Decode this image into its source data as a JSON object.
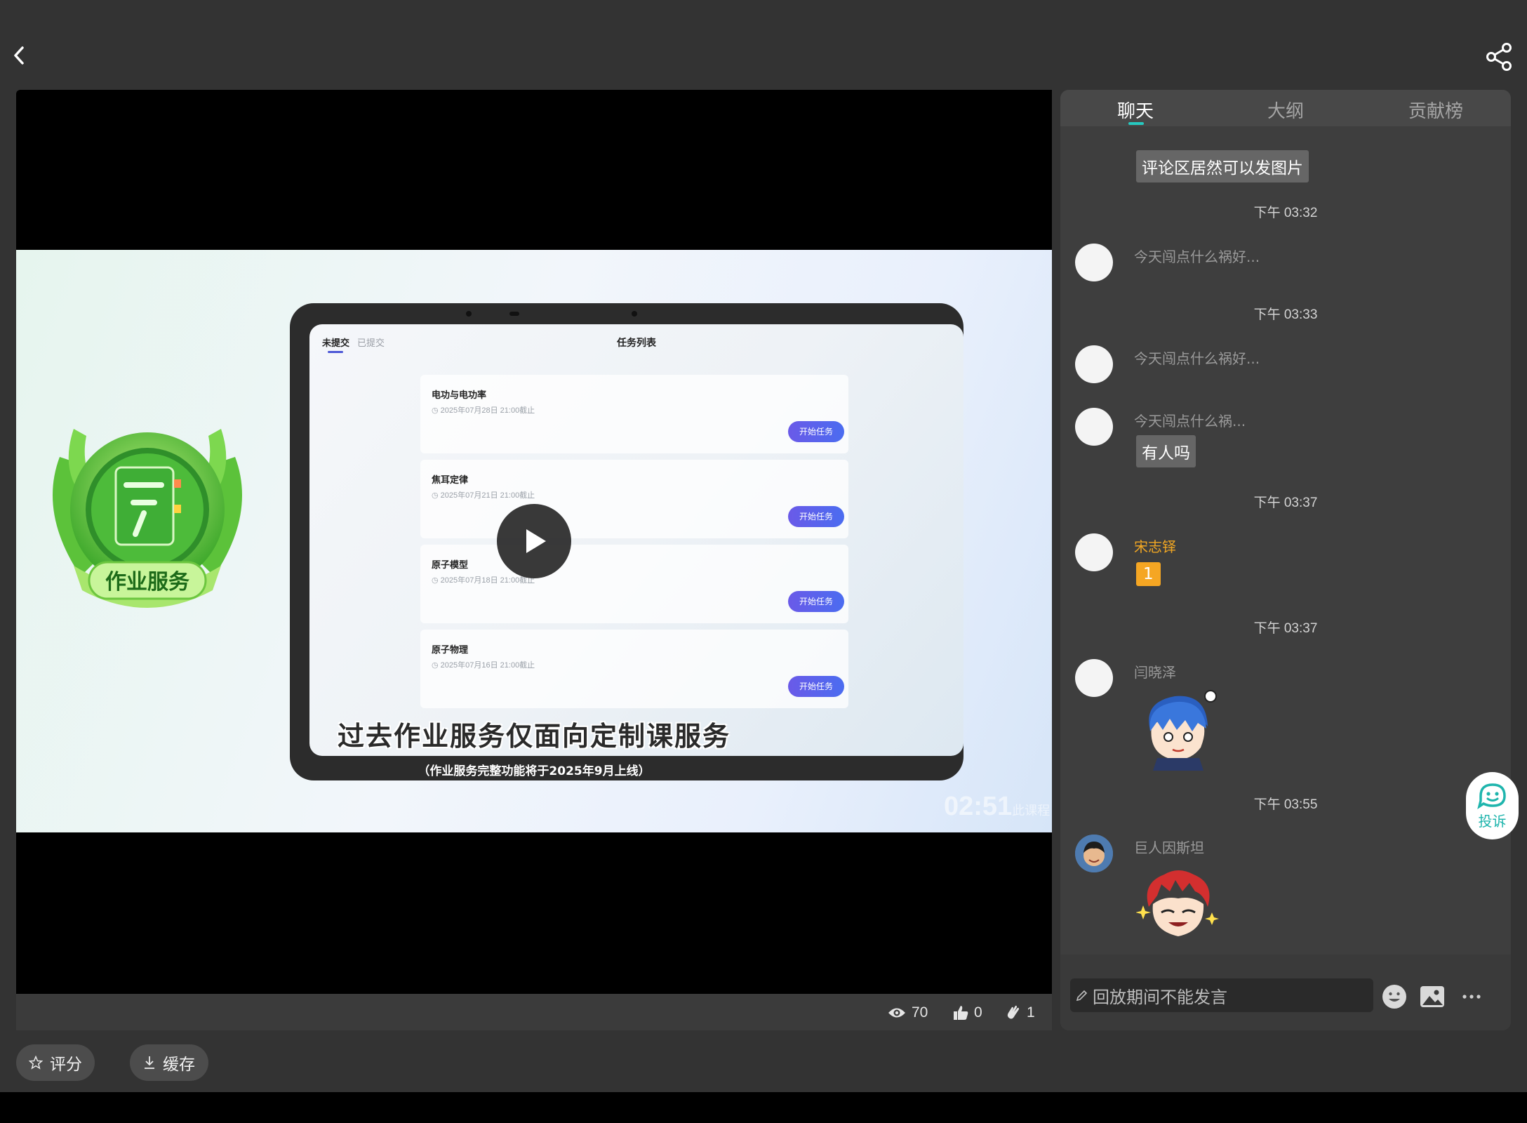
{
  "toolbar": {
    "back_icon": "chevron-left-icon",
    "share_icon": "share-icon"
  },
  "video": {
    "tablet_tabs": {
      "active": "未提交",
      "inactive": "已提交"
    },
    "tablet_title": "任务列表",
    "badge_text": "作业服务",
    "tasks": [
      {
        "title": "电功与电功率",
        "deadline": "2025年07月28日 21:00截止",
        "button": "开始任务"
      },
      {
        "title": "焦耳定律",
        "deadline": "2025年07月21日 21:00截止",
        "button": "开始任务"
      },
      {
        "title": "原子模型",
        "deadline": "2025年07月18日 21:00截止",
        "button": "开始任务"
      },
      {
        "title": "原子物理",
        "deadline": "2025年07月16日 21:00截止",
        "button": "开始任务"
      }
    ],
    "subtitle": "过去作业服务仅面向定制课服务",
    "subnote": "（作业服务完整功能将于2025年9月上线）",
    "timestamp_main": "02:51",
    "timestamp_suffix": "此课程",
    "stats": {
      "views": "70",
      "likes": "0",
      "claps": "1"
    }
  },
  "actions": {
    "rate_label": "评分",
    "cache_label": "缓存"
  },
  "chat": {
    "tabs": [
      "聊天",
      "大纲",
      "贡献榜"
    ],
    "active_tab": 0,
    "accent_color": "#26c9c0",
    "top_bubble": "评论区居然可以发图片",
    "items": [
      {
        "time": "下午 03:32"
      },
      {
        "name": "今天闯点什么祸好..."
      },
      {
        "time": "下午 03:33"
      },
      {
        "name": "今天闯点什么祸好..."
      },
      {
        "name": "今天闯点什么祸...",
        "text": "有人吗"
      },
      {
        "time": "下午 03:37"
      },
      {
        "name": "宋志铎",
        "text": "1"
      },
      {
        "time": "下午 03:37"
      },
      {
        "name": "闫晓泽"
      },
      {
        "time": "下午 03:55"
      },
      {
        "name": "巨人因斯坦"
      }
    ],
    "input_placeholder": "回放期间不能发言",
    "complaint_label": "投诉"
  }
}
